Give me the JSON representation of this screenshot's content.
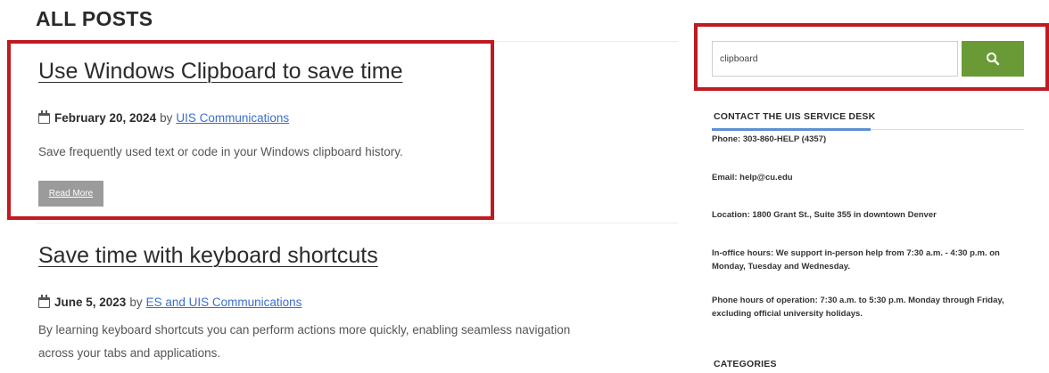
{
  "page": {
    "heading": "ALL POSTS"
  },
  "posts": [
    {
      "title": "Use Windows Clipboard to save time",
      "date": "February 20, 2024",
      "by": "by",
      "author": "UIS Communications",
      "excerpt": "Save frequently used text or code in your Windows clipboard history.",
      "read_more": "Read More"
    },
    {
      "title": "Save time with keyboard shortcuts",
      "date": "June 5, 2023",
      "by": "by",
      "author": "ES and UIS Communications",
      "excerpt_line1": "By learning keyboard shortcuts you can perform actions more quickly, enabling seamless navigation",
      "excerpt_line2": "across your tabs and applications."
    }
  ],
  "search": {
    "value": "clipboard",
    "button_icon": "search-icon"
  },
  "sidebar": {
    "contact_heading": "CONTACT THE UIS SERVICE DESK",
    "phone": "Phone: 303-860-HELP (4357)",
    "email": "Email: help@cu.edu",
    "location": "Location: 1800 Grant St., Suite 355 in downtown Denver",
    "inoffice": "In-office hours: We support in-person help from 7:30 a.m. - 4:30 p.m. on Monday, Tuesday and Wednesday.",
    "phone_hours": "Phone hours of operation: 7:30 a.m. to 5:30 p.m. Monday through Friday, excluding official university holidays.",
    "categories_heading": "CATEGORIES"
  },
  "colors": {
    "highlight": "#c01a21",
    "search_button": "#6a9a35",
    "link": "#3a6ecf",
    "accent": "#5b8fd6",
    "read_more_bg": "#9b9b9b"
  }
}
